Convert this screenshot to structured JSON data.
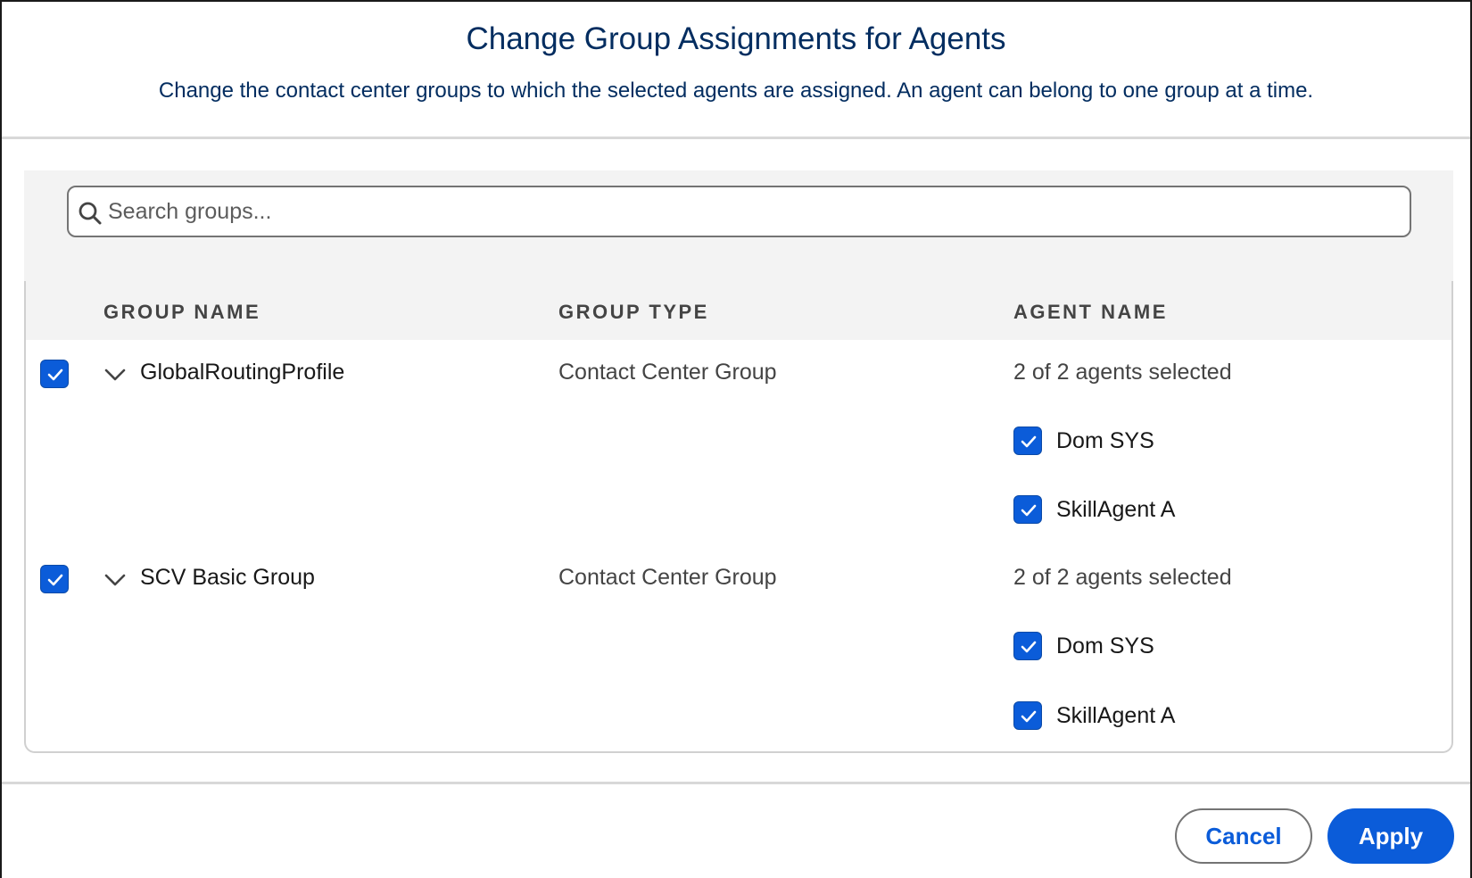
{
  "modal": {
    "title": "Change Group Assignments for Agents",
    "subtitle": "Change the contact center groups to which the selected agents are assigned. An agent can belong to one group at a time."
  },
  "search": {
    "placeholder": "Search groups...",
    "value": "",
    "icon": "search-icon"
  },
  "table": {
    "columns": [
      "GROUP NAME",
      "GROUP TYPE",
      "AGENT NAME"
    ],
    "groups": [
      {
        "checked": true,
        "expanded": true,
        "name": "GlobalRoutingProfile",
        "type": "Contact Center Group",
        "agents_summary": "2 of 2 agents selected",
        "agents": [
          {
            "name": "Dom SYS",
            "checked": true
          },
          {
            "name": "SkillAgent A",
            "checked": true
          }
        ]
      },
      {
        "checked": true,
        "expanded": true,
        "name": "SCV Basic Group",
        "type": "Contact Center Group",
        "agents_summary": "2 of 2 agents selected",
        "agents": [
          {
            "name": "Dom SYS",
            "checked": true
          },
          {
            "name": "SkillAgent A",
            "checked": true
          }
        ]
      }
    ]
  },
  "footer": {
    "cancel_label": "Cancel",
    "apply_label": "Apply"
  },
  "colors": {
    "title_text": "#032d60",
    "brand_blue": "#0b5cd9",
    "header_band": "#f3f3f3"
  }
}
